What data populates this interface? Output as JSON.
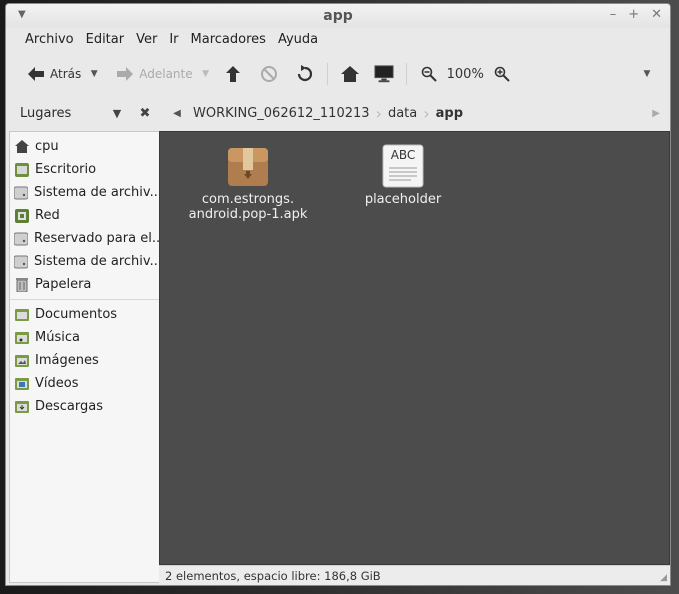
{
  "window": {
    "title": "app"
  },
  "menubar": {
    "items": [
      "Archivo",
      "Editar",
      "Ver",
      "Ir",
      "Marcadores",
      "Ayuda"
    ]
  },
  "toolbar": {
    "back_label": "Atrás",
    "forward_label": "Adelante",
    "zoom": "100%"
  },
  "sidebar": {
    "header": "Lugares",
    "places": [
      {
        "label": "cpu",
        "icon": "home-icon"
      },
      {
        "label": "Escritorio",
        "icon": "desktop-icon"
      },
      {
        "label": "Sistema de archiv...",
        "icon": "drive-icon"
      },
      {
        "label": "Red",
        "icon": "network-icon"
      },
      {
        "label": "Reservado para el...",
        "icon": "drive-icon"
      },
      {
        "label": "Sistema de archiv...",
        "icon": "drive-icon"
      },
      {
        "label": "Papelera",
        "icon": "trash-icon"
      }
    ],
    "bookmarks": [
      {
        "label": "Documentos",
        "icon": "folder-icon"
      },
      {
        "label": "Música",
        "icon": "music-folder-icon"
      },
      {
        "label": "Imágenes",
        "icon": "pictures-folder-icon"
      },
      {
        "label": "Vídeos",
        "icon": "videos-folder-icon"
      },
      {
        "label": "Descargas",
        "icon": "downloads-folder-icon"
      }
    ]
  },
  "pathbar": {
    "crumbs": [
      "WORKING_062612_110213",
      "data",
      "app"
    ]
  },
  "files": [
    {
      "name_line1": "com.estrongs.",
      "name_line2": "android.pop-1.apk",
      "icon": "package-icon"
    },
    {
      "name_line1": "placeholder",
      "name_line2": "",
      "icon": "text-file-icon",
      "icon_text": "ABC"
    }
  ],
  "status": {
    "text": "2 elementos, espacio libre: 186,8 GiB"
  },
  "colors": {
    "content_bg": "#4c4c4c",
    "window_bg": "#e9e9e9"
  }
}
